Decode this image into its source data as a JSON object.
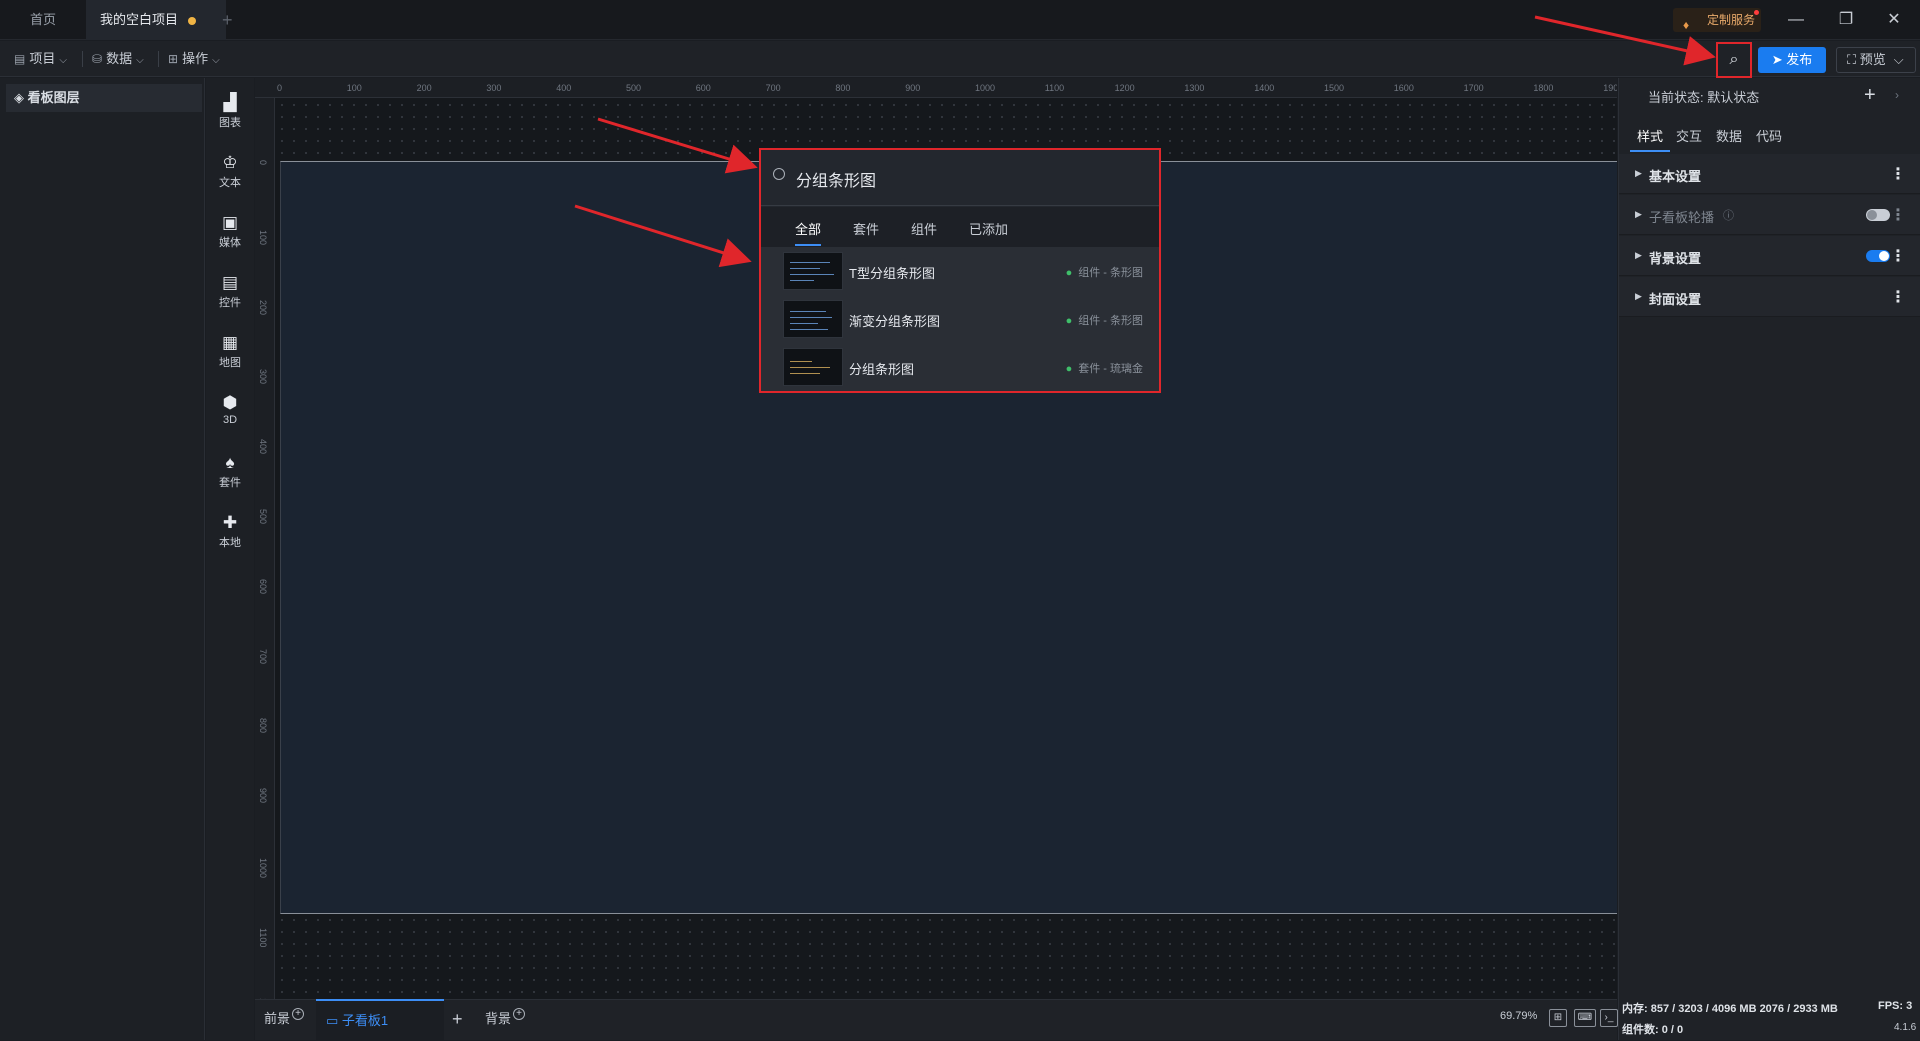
{
  "titlebar": {
    "tab_home": "首页",
    "tab_project": "我的空白项目",
    "tab_add": "+",
    "custom_service": "定制服务",
    "minimize": "—",
    "restore": "❐",
    "close": "✕"
  },
  "toolbar": {
    "menu_project": "项目",
    "menu_data": "数据",
    "menu_operate": "操作",
    "publish": "发布",
    "preview": "预览"
  },
  "layers": {
    "title": "看板图层"
  },
  "sidebar": {
    "items": [
      {
        "glyph": "▟",
        "label": "图表"
      },
      {
        "glyph": "♔",
        "label": "文本"
      },
      {
        "glyph": "▣",
        "label": "媒体"
      },
      {
        "glyph": "▤",
        "label": "控件"
      },
      {
        "glyph": "▦",
        "label": "地图"
      },
      {
        "glyph": "⬢",
        "label": "3D"
      },
      {
        "glyph": "♠",
        "label": "套件"
      },
      {
        "glyph": "✚",
        "label": "本地"
      }
    ]
  },
  "ruler": {
    "x_ticks": [
      "0",
      "100",
      "200",
      "300",
      "400",
      "500",
      "600",
      "700",
      "800",
      "900",
      "1000",
      "1100",
      "1200",
      "1300",
      "1400",
      "1500",
      "1600",
      "1700",
      "1800",
      "1900"
    ],
    "y_ticks": [
      "0",
      "100",
      "200",
      "300",
      "400",
      "500",
      "600",
      "700",
      "800",
      "900",
      "1000",
      "1100",
      "1200"
    ]
  },
  "bottom": {
    "foreground": "前景",
    "subboard": "子看板1",
    "add": "+",
    "background": "背景",
    "zoom": "69.79%"
  },
  "right_panel": {
    "state_label": "当前状态:",
    "state_value": "默认状态",
    "tabs": [
      "样式",
      "交互",
      "数据",
      "代码"
    ],
    "sections": [
      {
        "title": "基本设置"
      },
      {
        "title": "子看板轮播"
      },
      {
        "title": "背景设置"
      },
      {
        "title": "封面设置"
      }
    ],
    "status_memory": "内存: 857 / 3203 / 4096 MB  2076 / 2933 MB",
    "status_fps": "FPS: 3",
    "status_count": "组件数: 0 / 0",
    "version": "4.1.6"
  },
  "search_popup": {
    "query": "分组条形图",
    "tabs": [
      "全部",
      "套件",
      "组件",
      "已添加"
    ],
    "results": [
      {
        "name": "T型分组条形图",
        "tag": "组件 - 条形图"
      },
      {
        "name": "渐变分组条形图",
        "tag": "组件 - 条形图"
      },
      {
        "name": "分组条形图",
        "tag": "套件 - 琉璃金"
      }
    ]
  },
  "colors": {
    "accent": "#1a7cf0",
    "highlight_red": "#e0262b",
    "artboard": "#1b2431",
    "unsaved_dot": "#f0b444"
  }
}
